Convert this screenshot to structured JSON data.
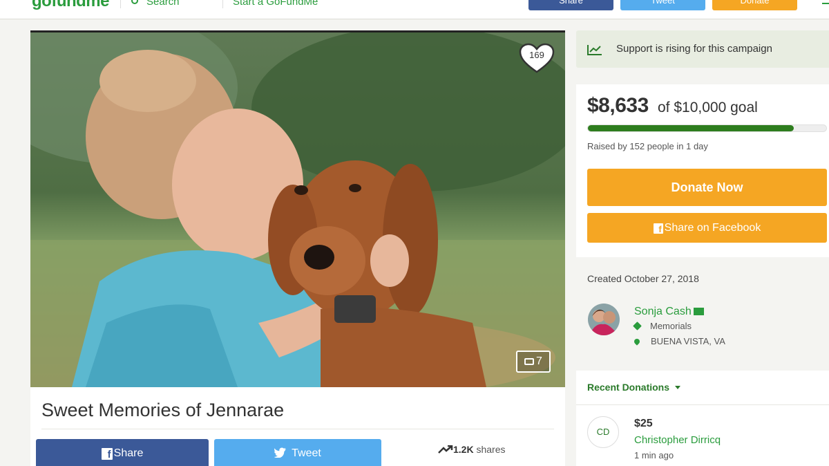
{
  "header": {
    "logo": "gofundme",
    "search_label": "Search",
    "start_label": "Start a GoFundMe",
    "share_label": "Share",
    "tweet_label": "Tweet",
    "donate_label": "Donate"
  },
  "campaign": {
    "title": "Sweet Memories of Jennarae",
    "hearts": "169",
    "photo_count": "7",
    "share_label": "Share",
    "tweet_label": "Tweet",
    "shares_count": "1.2K",
    "shares_label": "shares"
  },
  "sidebar": {
    "rising_text": "Support is rising for this campaign",
    "amount": "$8,633",
    "goal_text": "of $10,000 goal",
    "progress_fraction": 0.8633,
    "raised_text": "Raised by 152 people in 1 day",
    "donate_now_label": "Donate Now",
    "share_facebook_label": "Share on Facebook",
    "created": "Created October 27, 2018",
    "organizer": {
      "name": "Sonja Cash",
      "category": "Memorials",
      "location": "BUENA VISTA, VA"
    },
    "recent_donations_label": "Recent Donations",
    "donations": [
      {
        "initials": "CD",
        "amount": "$25",
        "name": "Christopher Dirricq",
        "time": "1 min ago"
      }
    ]
  },
  "colors": {
    "brand_green": "#2a9c3d",
    "donate_orange": "#f5a623",
    "facebook_blue": "#3b5998",
    "twitter_blue": "#55acee",
    "progress_green": "#2e7d1e"
  }
}
